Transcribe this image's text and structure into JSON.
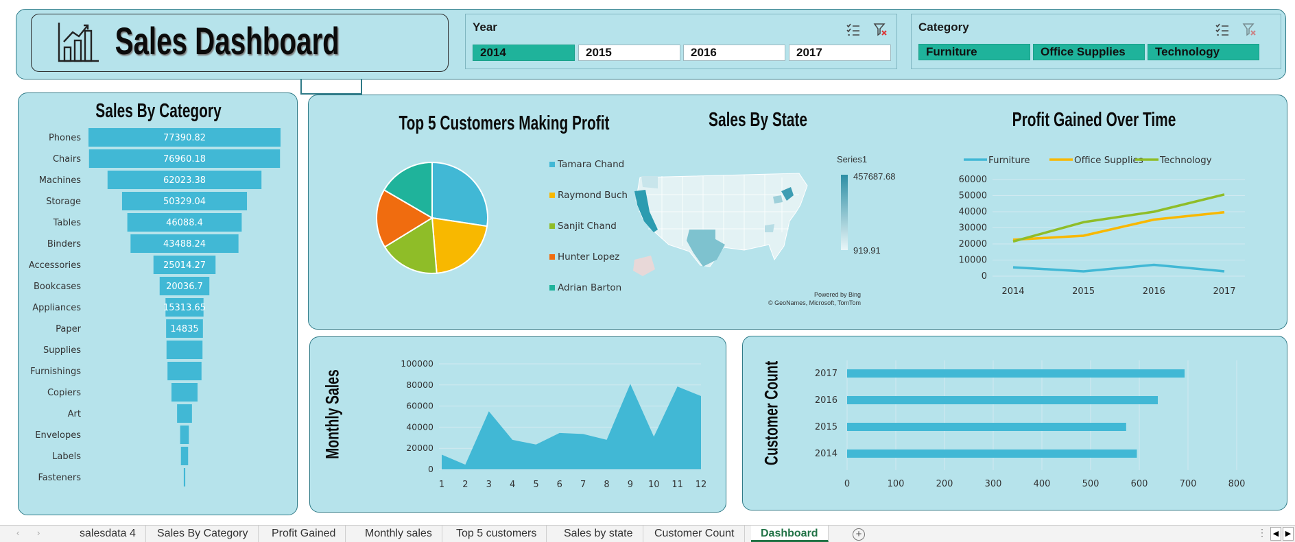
{
  "header": {
    "title": "Sales Dashboard",
    "logo_icon": "bar-chart-icon"
  },
  "year_slicer": {
    "label": "Year",
    "items": [
      {
        "label": "2014",
        "selected": true
      },
      {
        "label": "2015",
        "selected": false
      },
      {
        "label": "2016",
        "selected": false
      },
      {
        "label": "2017",
        "selected": false
      }
    ]
  },
  "category_slicer": {
    "label": "Category",
    "items": [
      {
        "label": "Furniture",
        "selected": true
      },
      {
        "label": "Office Supplies",
        "selected": true
      },
      {
        "label": "Technology",
        "selected": true
      }
    ]
  },
  "funnel": {
    "title": "Sales By Category",
    "color": "#41b8d5",
    "chart_data": {
      "type": "bar",
      "categories": [
        "Phones",
        "Chairs",
        "Machines",
        "Storage",
        "Tables",
        "Binders",
        "Accessories",
        "Bookcases",
        "Appliances",
        "Paper",
        "Supplies",
        "Furnishings",
        "Copiers",
        "Art",
        "Envelopes",
        "Labels",
        "Fasteners"
      ],
      "values": [
        77390.82,
        76960.18,
        62023.38,
        50329.04,
        46088.4,
        43488.24,
        25014.27,
        20036.7,
        15313.65,
        14835,
        14500,
        13700,
        10500,
        6000,
        3500,
        2900,
        600
      ],
      "value_labels": [
        "77390.82",
        "76960.18",
        "62023.38",
        "50329.04",
        "46088.4",
        "43488.24",
        "25014.27",
        "20036.7",
        "15313.65",
        "14835",
        "",
        "",
        "",
        "",
        "",
        "",
        ""
      ]
    }
  },
  "pie": {
    "title": "Top 5 Customers Making Profit",
    "chart_data": {
      "type": "pie",
      "categories": [
        "Tamara Chand",
        "Raymond Buch",
        "Sanjit Chand",
        "Hunter Lopez",
        "Adrian Barton"
      ],
      "values": [
        8981,
        6976,
        5757,
        5622,
        5444
      ],
      "colors": [
        "#41b8d5",
        "#f8b800",
        "#8fbd28",
        "#f06c0f",
        "#1fb39b"
      ]
    }
  },
  "map": {
    "title": "Sales By State",
    "legend_title": "Series1",
    "max_label": "457687.68",
    "min_label": "919.91",
    "credit_line1": "Powered by Bing",
    "credit_line2": "© GeoNames, Microsoft, TomTom"
  },
  "line": {
    "title": "Profit Gained Over Time",
    "chart_data": {
      "type": "line",
      "x": [
        "2014",
        "2015",
        "2016",
        "2017"
      ],
      "ylim": [
        0,
        60000
      ],
      "yticks": [
        "0",
        "10000",
        "20000",
        "30000",
        "40000",
        "50000",
        "60000"
      ],
      "series": [
        {
          "name": "Furniture",
          "color": "#41b8d5",
          "values": [
            5500,
            3000,
            7000,
            3000
          ]
        },
        {
          "name": "Office Supplies",
          "color": "#f8b800",
          "values": [
            22600,
            25100,
            35100,
            39700
          ]
        },
        {
          "name": "Technology",
          "color": "#8fbd28",
          "values": [
            21500,
            33500,
            40000,
            50700
          ]
        }
      ]
    }
  },
  "area": {
    "ylabel": "Monthly Sales",
    "color": "#41b8d5",
    "chart_data": {
      "type": "area",
      "x": [
        "1",
        "2",
        "3",
        "4",
        "5",
        "6",
        "7",
        "8",
        "9",
        "10",
        "11",
        "12"
      ],
      "values": [
        14000,
        4500,
        55000,
        28000,
        23500,
        34500,
        33500,
        28000,
        81000,
        31000,
        78500,
        69500
      ],
      "ylim": [
        0,
        100000
      ],
      "yticks": [
        "0",
        "20000",
        "40000",
        "60000",
        "80000",
        "100000"
      ]
    }
  },
  "hbar": {
    "ylabel": "Customer Count",
    "color": "#41b8d5",
    "chart_data": {
      "type": "bar",
      "categories": [
        "2017",
        "2016",
        "2015",
        "2014"
      ],
      "values": [
        693,
        638,
        573,
        595
      ],
      "xlim": [
        0,
        800
      ],
      "xticks": [
        "0",
        "100",
        "200",
        "300",
        "400",
        "500",
        "600",
        "700",
        "800"
      ]
    }
  },
  "tabs": [
    {
      "label": "salesdata 4",
      "active": false
    },
    {
      "label": "Sales By Category",
      "active": false
    },
    {
      "label": "Profit Gained",
      "active": false
    },
    {
      "label": "Monthly sales",
      "active": false
    },
    {
      "label": "Top 5 customers",
      "active": false
    },
    {
      "label": "Sales by state",
      "active": false
    },
    {
      "label": "Customer Count",
      "active": false
    },
    {
      "label": "Dashboard",
      "active": true
    }
  ]
}
